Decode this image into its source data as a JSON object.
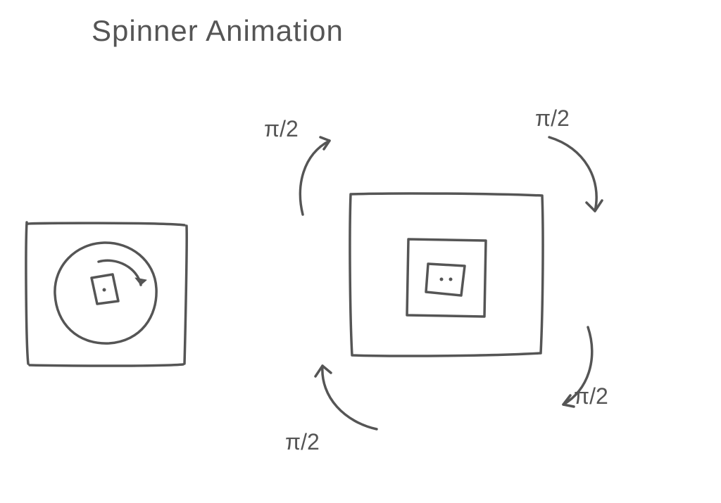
{
  "title": "Spinner Animation",
  "angle_labels": {
    "top_left": "π/2",
    "top_right": "π/2",
    "bottom_right": "π/2",
    "bottom_left": "π/2"
  },
  "diagram": {
    "description": "Hand-drawn sketch showing a spinner animation concept with two box diagrams and four curved rotation arrows each labeled π/2",
    "left_box": {
      "description": "Square frame containing a circle with a small rotated square/diamond inside and a curved arrow indicating rotation"
    },
    "right_box": {
      "description": "Larger square frame with a nested smaller square/diamond inside, surrounded by four curved arrows at corners indicating full rotation in π/2 steps"
    }
  }
}
